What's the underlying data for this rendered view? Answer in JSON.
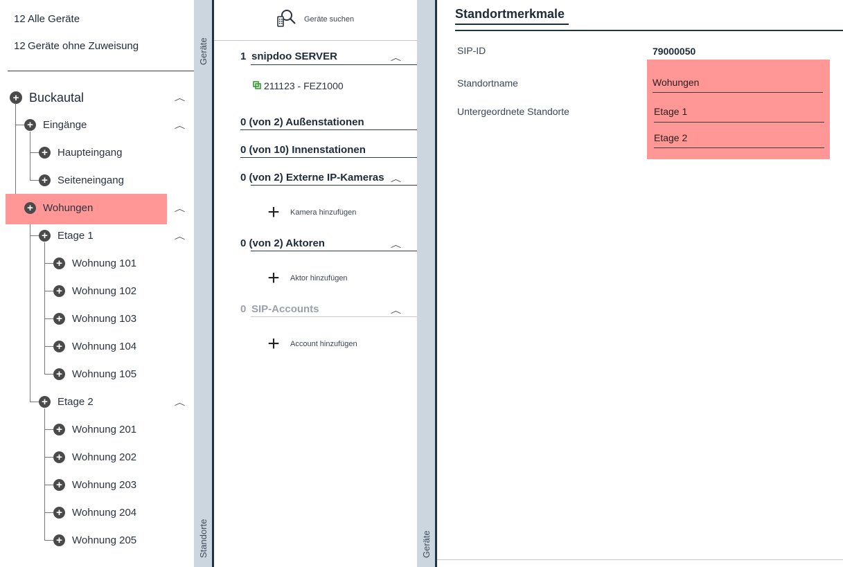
{
  "left": {
    "summary": [
      {
        "count": "12",
        "label": "Alle Geräte"
      },
      {
        "count": "12",
        "label": "Geräte ohne Zuweisung"
      }
    ],
    "tree": {
      "root": "Buckautal",
      "eingaenge": "Eingänge",
      "haupteingang": "Haupteingang",
      "seiteneingang": "Seiteneingang",
      "wohungen": "Wohungen",
      "etage1": "Etage 1",
      "w101": "Wohnung 101",
      "w102": "Wohnung 102",
      "w103": "Wohnung 103",
      "w104": "Wohnung 104",
      "w105": "Wohnung 105",
      "etage2": "Etage 2",
      "w201": "Wohnung 201",
      "w202": "Wohnung 202",
      "w203": "Wohnung 203",
      "w204": "Wohnung 204",
      "w205": "Wohnung 205"
    },
    "highlight_color": "#ff9797"
  },
  "sidebars": {
    "geraete_top": "Geräte",
    "standorte": "Standorte",
    "geraete_bottom": "Geräte"
  },
  "mid": {
    "search_label": "Geräte suchen",
    "sections": {
      "server": {
        "count": "1",
        "label": "snipdoo SERVER"
      },
      "device": "211123 - FEZ1000",
      "aussen": {
        "count": "0",
        "label": "(von 2) Außenstationen"
      },
      "innen": {
        "count": "0",
        "label": "(von 10) Innenstationen"
      },
      "kameras": {
        "count": "0",
        "label": "(von 2) Externe IP-Kameras"
      },
      "kamera_add": "Kamera hinzufügen",
      "aktoren": {
        "count": "0",
        "label": "(von 2) Aktoren"
      },
      "aktor_add": "Aktor hinzufügen",
      "sip": {
        "count": "0",
        "label": "SIP-Accounts"
      },
      "account_add": "Account hinzufügen"
    }
  },
  "right": {
    "title": "Standortmerkmale",
    "sip_label": "SIP-ID",
    "sip_value": "79000050",
    "name_label": "Standortname",
    "name_value": "Wohungen",
    "sub_label": "Untergeordnete Standorte",
    "sub_values": [
      "Etage 1",
      "Etage 2"
    ]
  },
  "icons": {
    "expand": "chevron-up-icon",
    "node": "plus-circle-icon",
    "search": "device-search-icon",
    "device": "device-link-icon",
    "add": "plus-icon"
  }
}
